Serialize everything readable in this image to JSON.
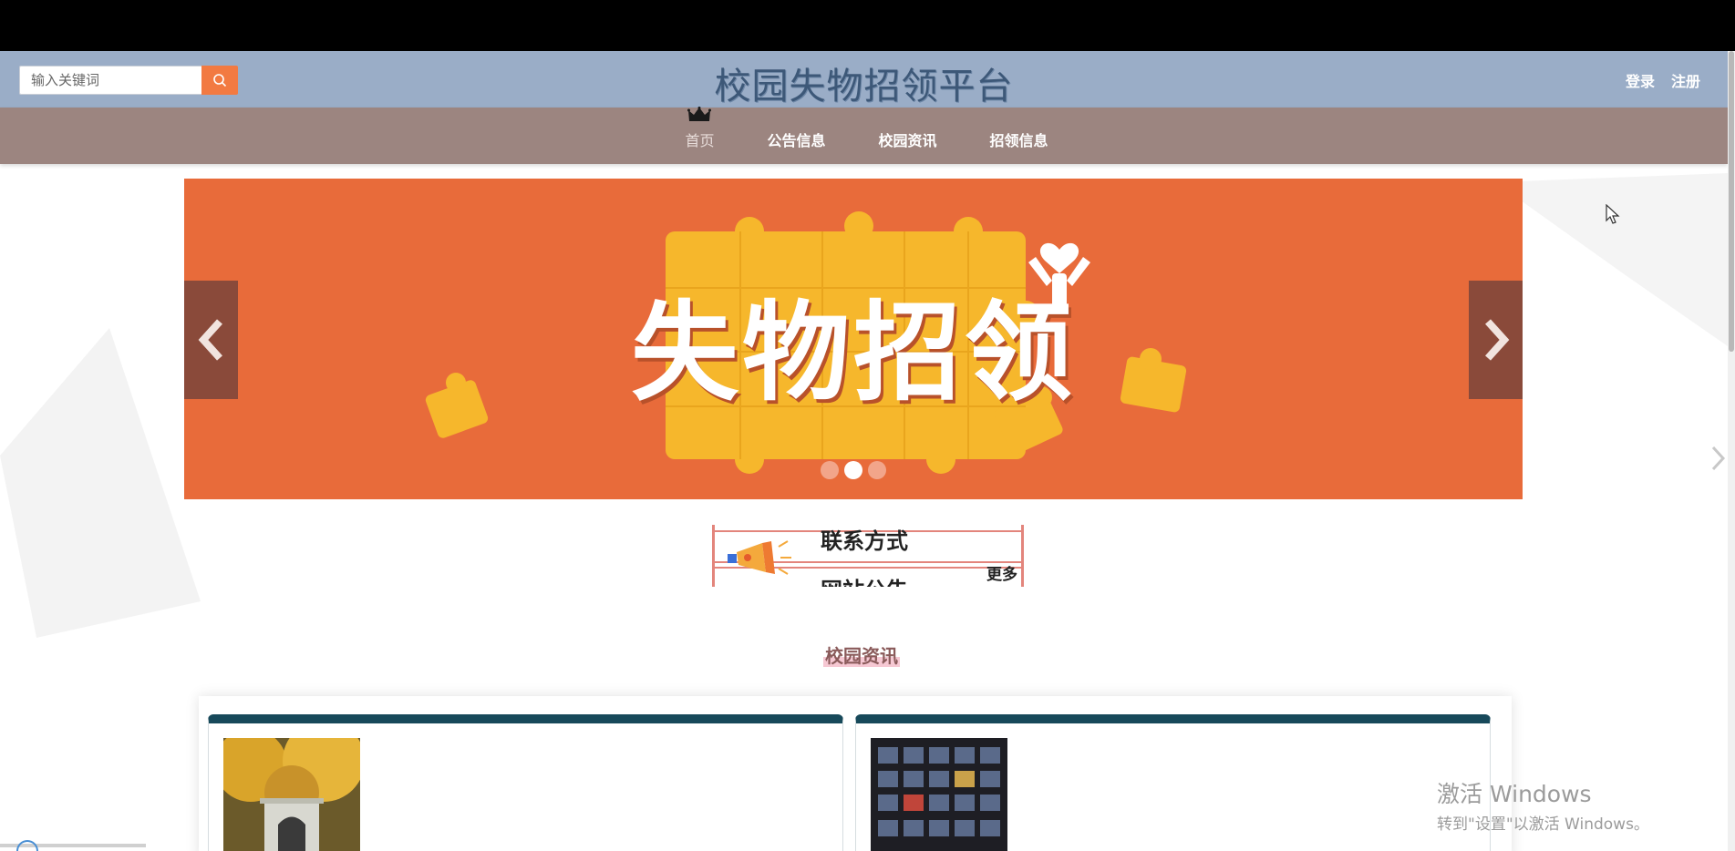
{
  "header": {
    "search_placeholder": "输入关键词",
    "site_title": "校园失物招领平台",
    "login_label": "登录",
    "register_label": "注册"
  },
  "nav": {
    "items": [
      {
        "label": "首页",
        "active": true
      },
      {
        "label": "公告信息",
        "active": false
      },
      {
        "label": "校园资讯",
        "active": false
      },
      {
        "label": "招领信息",
        "active": false
      }
    ]
  },
  "banner": {
    "title": "失物招领",
    "slides_total": 3,
    "active_slide": 2
  },
  "notice": {
    "items": [
      "联系方式",
      "网站公告"
    ],
    "more_label": "更多"
  },
  "news_section": {
    "title": "校园资讯"
  },
  "os_overlay": {
    "activate_line1": "激活 Windows",
    "activate_line2": "转到\"设置\"以激活 Windows。"
  },
  "colors": {
    "header_bg": "#9aadc7",
    "nav_bg": "#9c8580",
    "banner_bg": "#e86b3a",
    "search_button": "#f27a42",
    "card_top": "#17495a",
    "title_text": "#3d5878"
  }
}
